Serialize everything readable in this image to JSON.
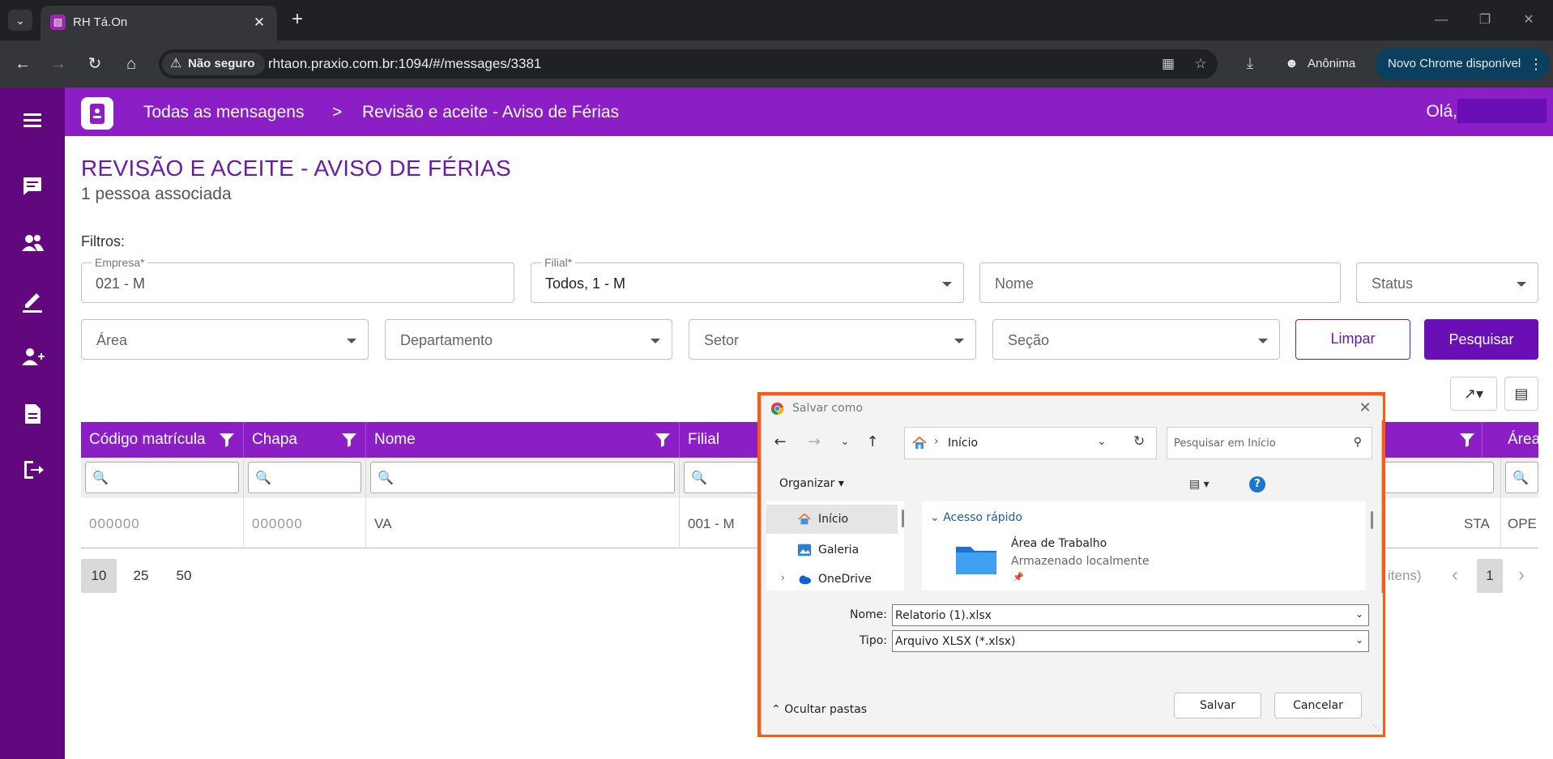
{
  "browser": {
    "tab_title": "RH Tá.On",
    "not_secure": "Não seguro",
    "url": "rhtaon.praxio.com.br:1094/#/messages/3381",
    "incognito": "Anônima",
    "update": "Novo Chrome disponível"
  },
  "header": {
    "breadcrumb_root": "Todas as mensagens",
    "breadcrumb_sep": ">",
    "breadcrumb_current": "Revisão e aceite - Aviso de Férias",
    "greeting": "Olá,"
  },
  "page": {
    "title": "REVISÃO E ACEITE - AVISO DE FÉRIAS",
    "subtitle": "1 pessoa associada",
    "filters_label": "Filtros:"
  },
  "filters": {
    "empresa": {
      "label": "Empresa*",
      "value": "021 - M"
    },
    "filial": {
      "label": "Filial*",
      "value": "Todos, 1 - M"
    },
    "nome": {
      "placeholder": "Nome"
    },
    "status": {
      "placeholder": "Status"
    },
    "area": {
      "placeholder": "Área"
    },
    "departamento": {
      "placeholder": "Departamento"
    },
    "setor": {
      "placeholder": "Setor"
    },
    "secao": {
      "placeholder": "Seção"
    },
    "clear_label": "Limpar",
    "search_label": "Pesquisar"
  },
  "grid": {
    "columns": [
      "Código matrícula",
      "Chapa",
      "Nome",
      "Filial",
      "",
      "Área"
    ],
    "row": {
      "codigo": "000000",
      "chapa": "000000",
      "nome": "VA",
      "filial": "001 - M",
      "cargo": "STA",
      "area": "OPE"
    }
  },
  "pager": {
    "sizes": [
      "10",
      "25",
      "50"
    ],
    "info": "itens)",
    "current_page": "1"
  },
  "dialog": {
    "title": "Salvar como",
    "location": "Início",
    "search_placeholder": "Pesquisar em Início",
    "organize": "Organizar",
    "nav_items": [
      "Início",
      "Galeria",
      "OneDrive"
    ],
    "quick_access": "Acesso rápido",
    "folder_name": "Área de Trabalho",
    "folder_sub": "Armazenado localmente",
    "name_label": "Nome:",
    "name_value": "Relatorio (1).xlsx",
    "type_label": "Tipo:",
    "type_value": "Arquivo XLSX (*.xlsx)",
    "hide_folders": "Ocultar pastas",
    "save_label": "Salvar",
    "cancel_label": "Cancelar"
  },
  "colors": {
    "sidebar": "#61087e",
    "header": "#8b1ec4",
    "primary": "#6a0fb5",
    "highlight": "#ff5a12"
  }
}
